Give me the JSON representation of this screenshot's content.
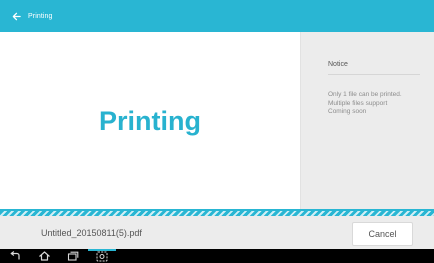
{
  "app_bar": {
    "title": "Printing"
  },
  "main": {
    "status_text": "Printing"
  },
  "notice": {
    "heading": "Notice",
    "line1": "Only 1 file can be printed.",
    "line2": "Multiple files support",
    "line3": "Coming soon"
  },
  "footer": {
    "filename": "Untitled_20150811(5).pdf",
    "cancel_label": "Cancel"
  },
  "system_nav": {
    "buttons": [
      "back-icon",
      "home-icon",
      "recent-apps-icon",
      "screenshot-icon"
    ]
  },
  "colors": {
    "accent": "#29b6d3",
    "panel_bg": "#ececec"
  }
}
